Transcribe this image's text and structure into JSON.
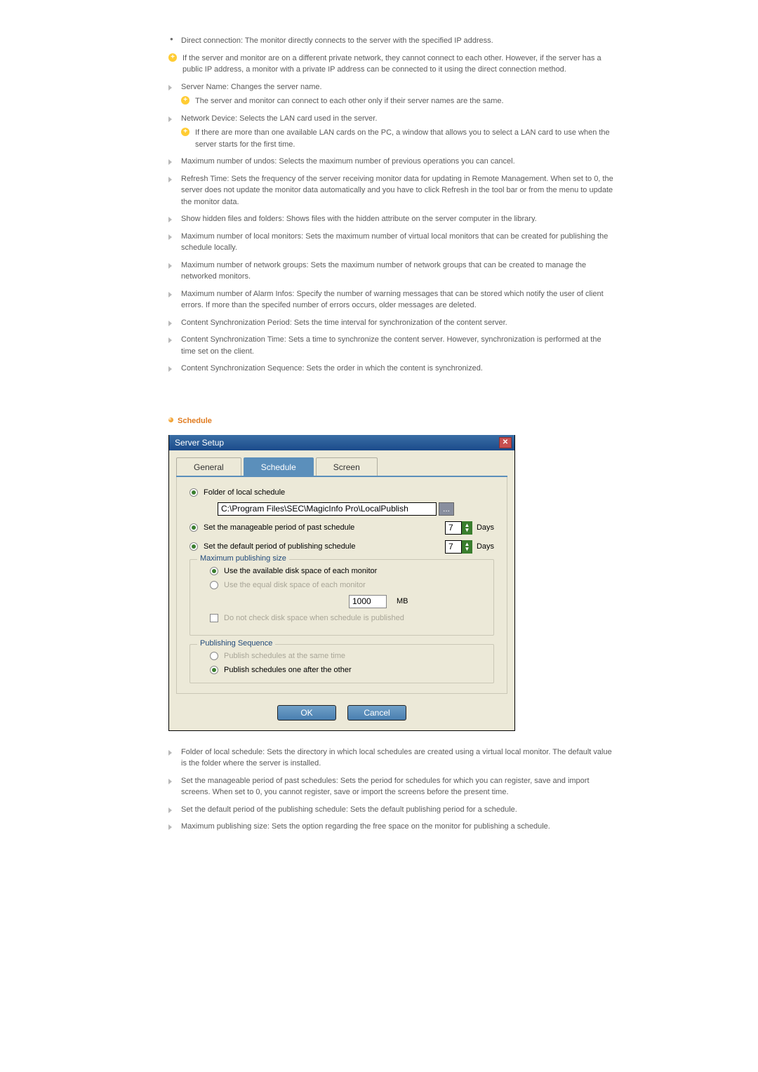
{
  "doc": {
    "bullets": [
      "Direct connection: The monitor directly connects to the server with the specified IP address."
    ],
    "note1": "If the server and monitor are on a different private network, they cannot connect to each other. However, if the server has a public IP address, a monitor with a private IP address can be connected to it using the direct connection method.",
    "items": {
      "serverName": "Server Name: Changes the server name.",
      "serverNameNote": "The server and monitor can connect to each other only if their server names are the same.",
      "networkDevice": "Network Device: Selects the LAN card used in the server.",
      "networkDeviceNote": "If there are more than one available LAN cards on the PC, a window that allows you to select a LAN card to use when the server starts for the first time.",
      "maxUndos": "Maximum number of undos: Selects the maximum number of previous operations you can cancel.",
      "refreshTime": "Refresh Time: Sets the frequency of the server receiving monitor data for updating in Remote Management. When set to 0, the server does not update the monitor data automatically and you have to click Refresh in the tool bar or from the menu to update the monitor data.",
      "showHidden": "Show hidden files and folders: Shows files with the hidden attribute on the server computer in the library.",
      "maxLocalMon": "Maximum number of local monitors: Sets the maximum number of virtual local monitors that can be created for publishing the schedule locally.",
      "maxNetGroups": "Maximum number of network groups: Sets the maximum number of network groups that can be created to manage the networked monitors.",
      "maxAlarm": "Maximum number of Alarm Infos: Specify the number of warning messages that can be stored which notify the user of client errors. If more than the specifed number of errors occurs, older messages are deleted.",
      "syncPeriod": "Content Synchronization Period: Sets the time interval for synchronization of the content server.",
      "syncTime": "Content Synchronization Time: Sets a time to synchronize the content server. However, synchronization is performed at the time set on the client.",
      "syncSeq": "Content Synchronization Sequence: Sets the order in which the content is synchronized."
    },
    "scheduleTitle": "Schedule",
    "dlg": {
      "title": "Server Setup",
      "tabs": {
        "general": "General",
        "schedule": "Schedule",
        "screen": "Screen"
      },
      "folderLabel": "Folder of local schedule",
      "folderPath": "C:\\Program Files\\SEC\\MagicInfo Pro\\LocalPublish",
      "browse": "...",
      "pastLabel": "Set the manageable period of past schedule",
      "pastVal": "7",
      "defPubLabel": "Set the default period of publishing schedule",
      "defPubVal": "7",
      "daysLabel": "Days",
      "maxPubTitle": "Maximum publishing size",
      "availLabel": "Use the available disk space of each monitor",
      "equalLabel": "Use the equal disk space of each monitor",
      "mbVal": "1000",
      "mbUnit": "MB",
      "noCheckLabel": "Do not check disk space when schedule is published",
      "pubSeqTitle": "Publishing Sequence",
      "sameTimeLabel": "Publish schedules at the same time",
      "oneAfterLabel": "Publish schedules one after the other",
      "ok": "OK",
      "cancel": "Cancel"
    },
    "after": {
      "folder": "Folder of local schedule: Sets the directory in which local schedules are created using a virtual local monitor. The default value is the folder where the server is installed.",
      "past": "Set the manageable period of past schedules: Sets the period for schedules for which you can register, save and import screens. When set to 0, you cannot register, save or import the screens before the present time.",
      "defpub": "Set the default period of the publishing schedule: Sets the default publishing period for a schedule.",
      "maxpub": "Maximum publishing size: Sets the option regarding the free space on the monitor for publishing a schedule."
    }
  }
}
